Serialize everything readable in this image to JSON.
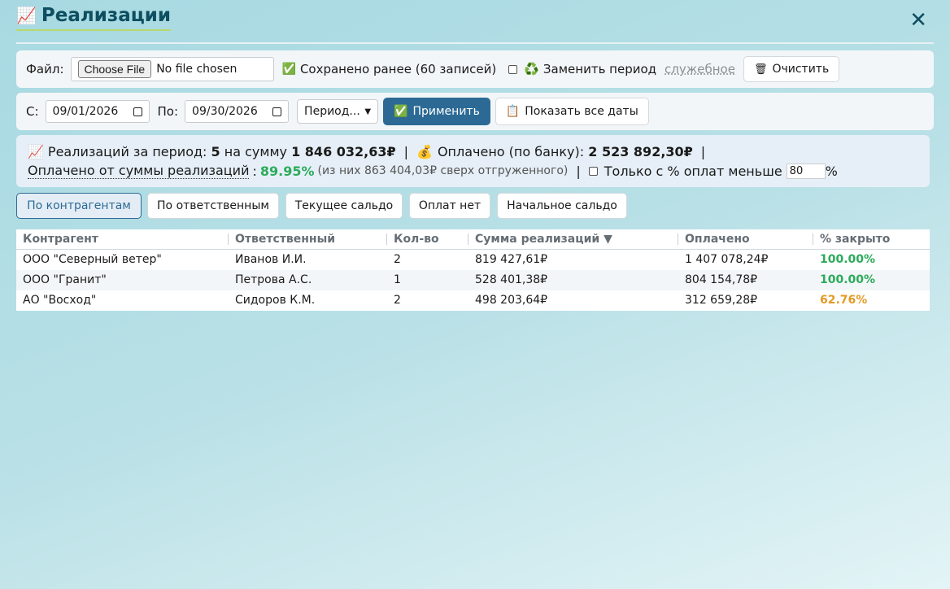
{
  "header": {
    "title_icon": "📈",
    "title": "Реализации",
    "close": "✕"
  },
  "file_panel": {
    "file_label": "Файл:",
    "choose_file": "Choose File",
    "no_file": "No file chosen",
    "saved_icon": "✅",
    "saved_text": "Сохранено ранее (60 записей)",
    "replace_icon": "♻️",
    "replace_label": "Заменить период",
    "service_link": "служебное",
    "clear_icon": "🗑",
    "clear_label": "Очистить"
  },
  "date_panel": {
    "from_label": "С:",
    "from_value": "09/01/2026",
    "to_label": "По:",
    "to_value": "09/30/2026",
    "period_select": "Период...",
    "apply_icon": "✅",
    "apply_label": "Применить",
    "show_all_icon": "📋",
    "show_all_label": "Показать все даты"
  },
  "stats": {
    "icon1": "📈",
    "count_label": "Реализаций за период:",
    "count": "5",
    "sum_label": "на сумму",
    "sum": "1 846 032,63₽",
    "sep": "|",
    "icon2": "💰",
    "paid_label": "Оплачено (по банку):",
    "paid": "2 523 892,30₽",
    "paid_of_label": "Оплачено от суммы реализаций",
    "colon": ":",
    "paid_of_pct": "89.95%",
    "paid_of_note": "(из них 863 404,03₽ сверх отгруженного)",
    "only_label": "Только с % оплат меньше",
    "only_value": "80",
    "pct_sign": "%"
  },
  "tabs": [
    {
      "label": "По контрагентам"
    },
    {
      "label": "По ответственным"
    },
    {
      "label": "Текущее сальдо"
    },
    {
      "label": "Оплат нет"
    },
    {
      "label": "Начальное сальдо"
    }
  ],
  "table": {
    "columns": [
      "Контрагент",
      "Ответственный",
      "Кол-во",
      "Сумма реализаций ▼",
      "Оплачено",
      "% закрыто"
    ],
    "rows": [
      [
        "ООО \"Северный ветер\"",
        "Иванов И.И.",
        "2",
        "819 427,61₽",
        "1 407 078,24₽",
        "100.00%"
      ],
      [
        "ООО \"Гранит\"",
        "Петрова А.С.",
        "1",
        "528 401,38₽",
        "804 154,78₽",
        "100.00%"
      ],
      [
        "АО \"Восход\"",
        "Сидоров К.М.",
        "2",
        "498 203,64₽",
        "312 659,28₽",
        "62.76%"
      ]
    ]
  },
  "colors": {
    "title": "#0d4e60",
    "primary": "#2c6a95",
    "green": "#2bab5b",
    "orange": "#e59a24"
  }
}
